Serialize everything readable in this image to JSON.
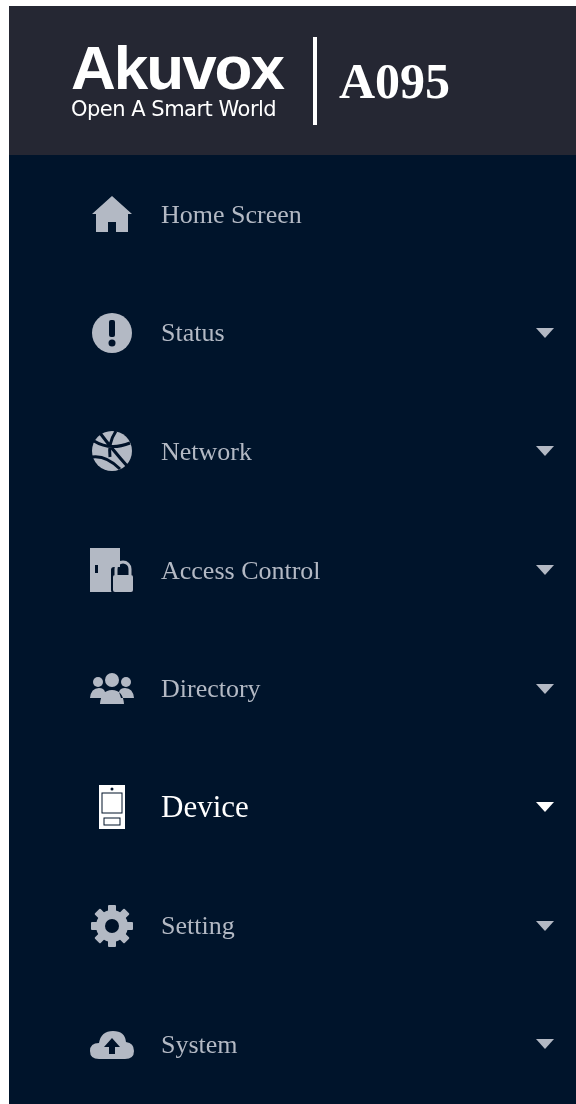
{
  "header": {
    "brand": "Akuvox",
    "tagline": "Open A Smart World",
    "model": "A095"
  },
  "menu": [
    {
      "label": "Home Screen",
      "selected": false,
      "expandable": false
    },
    {
      "label": "Status",
      "selected": false,
      "expandable": true
    },
    {
      "label": "Network",
      "selected": false,
      "expandable": true
    },
    {
      "label": "Access Control",
      "selected": false,
      "expandable": true
    },
    {
      "label": "Directory",
      "selected": false,
      "expandable": true
    },
    {
      "label": "Device",
      "selected": true,
      "expandable": true
    },
    {
      "label": "Setting",
      "selected": false,
      "expandable": true
    },
    {
      "label": "System",
      "selected": false,
      "expandable": true
    }
  ]
}
